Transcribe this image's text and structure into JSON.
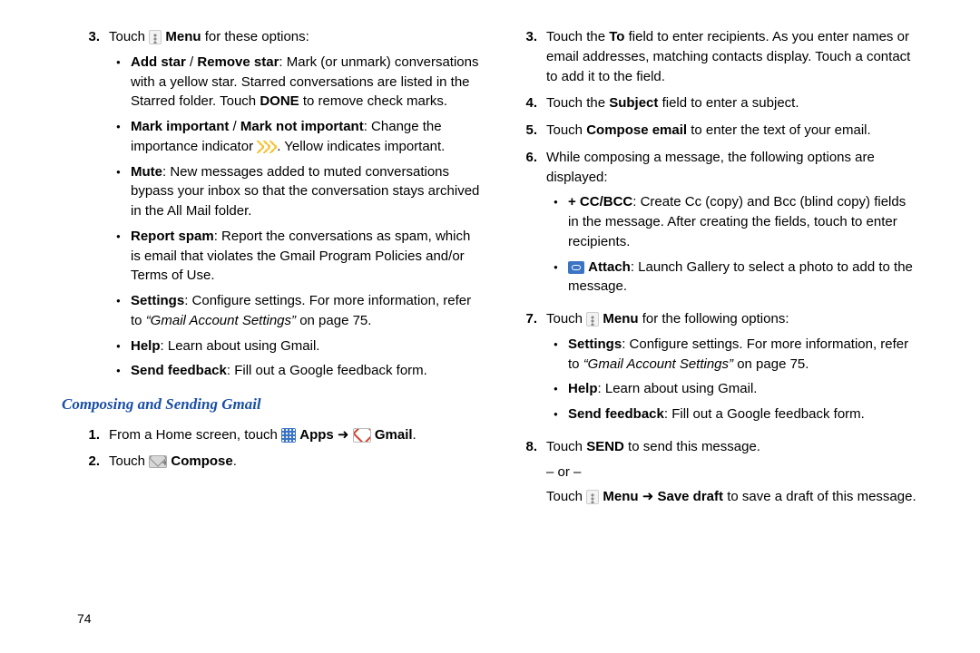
{
  "pageNumber": "74",
  "heading": "Composing and Sending Gmail",
  "left": {
    "step3": {
      "num": "3.",
      "lead_touch": "Touch ",
      "lead_menu": "Menu",
      "lead_rest": " for these options:",
      "bullets": [
        {
          "b": "Add star",
          "sep": " / ",
          "b2": "Remove star",
          "t": ": Mark (or unmark) conversations with a yellow star. Starred conversations are listed in the Starred folder. Touch ",
          "b3": "DONE",
          "t2": " to remove check marks."
        },
        {
          "b": "Mark important",
          "sep": " / ",
          "b2": "Mark not important",
          "t": ": Change the importance indicator ",
          "t2": ". Yellow indicates important."
        },
        {
          "b": "Mute",
          "t": ": New messages added to muted conversations bypass your inbox so that the conversation stays archived in the All Mail folder."
        },
        {
          "b": "Report spam",
          "t": ": Report the conversations as spam, which is email that violates the Gmail Program Policies and/or Terms of Use."
        },
        {
          "b": "Settings",
          "t": ": Configure settings. For more information, refer to ",
          "ref": "“Gmail Account Settings”",
          "t2": "  on page 75."
        },
        {
          "b": "Help",
          "t": ": Learn about using Gmail."
        },
        {
          "b": "Send feedback",
          "t": ": Fill out a Google feedback form."
        }
      ]
    },
    "step1": {
      "num": "1.",
      "pre": "From a Home screen, touch ",
      "apps": "Apps",
      "arrow": " ➜ ",
      "gmail": "Gmail",
      "post": "."
    },
    "step2": {
      "num": "2.",
      "pre": "Touch ",
      "compose": "Compose",
      "post": "."
    }
  },
  "right": {
    "steps": [
      {
        "num": "3.",
        "pre": "Touch the ",
        "b": "To",
        "t": " field to enter recipients. As you enter names or email addresses, matching contacts display. Touch a contact to add it to the field."
      },
      {
        "num": "4.",
        "pre": "Touch the ",
        "b": "Subject",
        "t": " field to enter a subject."
      },
      {
        "num": "5.",
        "pre": "Touch ",
        "b": "Compose email",
        "t": " to enter the text of your email."
      },
      {
        "num": "6.",
        "t": "While composing a message, the following options are displayed:",
        "bullets": [
          {
            "b": "+ CC/BCC",
            "t": ": Create Cc (copy) and Bcc (blind copy) fields in the message. After creating the fields, touch to enter recipients."
          },
          {
            "icon": "attach",
            "b": "Attach",
            "t": ": Launch Gallery to select a photo to add to the message."
          }
        ]
      },
      {
        "num": "7.",
        "pre": "Touch ",
        "b": "Menu",
        "t": " for the following options:",
        "bullets": [
          {
            "b": "Settings",
            "t": ": Configure settings. For more information, refer to ",
            "ref": "“Gmail Account Settings”",
            "t2": "  on page 75."
          },
          {
            "b": "Help",
            "t": ": Learn about using Gmail."
          },
          {
            "b": "Send feedback",
            "t": ": Fill out a Google feedback form."
          }
        ]
      },
      {
        "num": "8.",
        "pre": "Touch ",
        "b": "SEND",
        "t": " to send this message.",
        "or": "– or –",
        "pre2": "Touch ",
        "b2": "Menu",
        "arrow": " ➜ ",
        "b3": "Save draft",
        "t2": " to save a draft of this message."
      }
    ]
  }
}
